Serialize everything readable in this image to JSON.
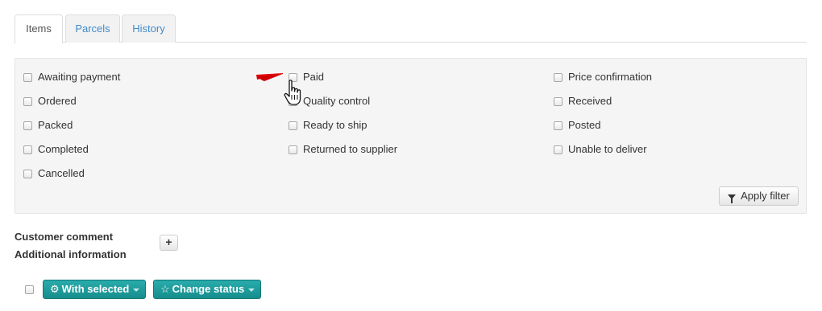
{
  "tabs": [
    {
      "label": "Items",
      "active": true
    },
    {
      "label": "Parcels",
      "active": false
    },
    {
      "label": "History",
      "active": false
    }
  ],
  "filter": {
    "statuses": [
      {
        "label": "Awaiting payment",
        "checked": false
      },
      {
        "label": "Ordered",
        "checked": false
      },
      {
        "label": "Packed",
        "checked": false
      },
      {
        "label": "Completed",
        "checked": false
      },
      {
        "label": "Cancelled",
        "checked": false
      },
      {
        "label": "Paid",
        "checked": false
      },
      {
        "label": "Quality control",
        "checked": false
      },
      {
        "label": "Ready to ship",
        "checked": false
      },
      {
        "label": "Returned to supplier",
        "checked": false
      },
      {
        "label": "Price confirmation",
        "checked": false
      },
      {
        "label": "Received",
        "checked": false
      },
      {
        "label": "Posted",
        "checked": false
      },
      {
        "label": "Unable to deliver",
        "checked": false
      }
    ],
    "apply_label": "Apply filter",
    "apply_icon": "filter-icon"
  },
  "info": {
    "customer_comment": "Customer comment",
    "additional_information": "Additional information",
    "add_symbol": "+"
  },
  "actions": {
    "with_selected_label": "With selected",
    "with_selected_icon": "gear-icon",
    "change_status_label": "Change status",
    "change_status_icon": "star-icon"
  },
  "colors": {
    "accent": "#1a9a9a",
    "link": "#428bca",
    "annotation_arrow": "#e00000"
  }
}
